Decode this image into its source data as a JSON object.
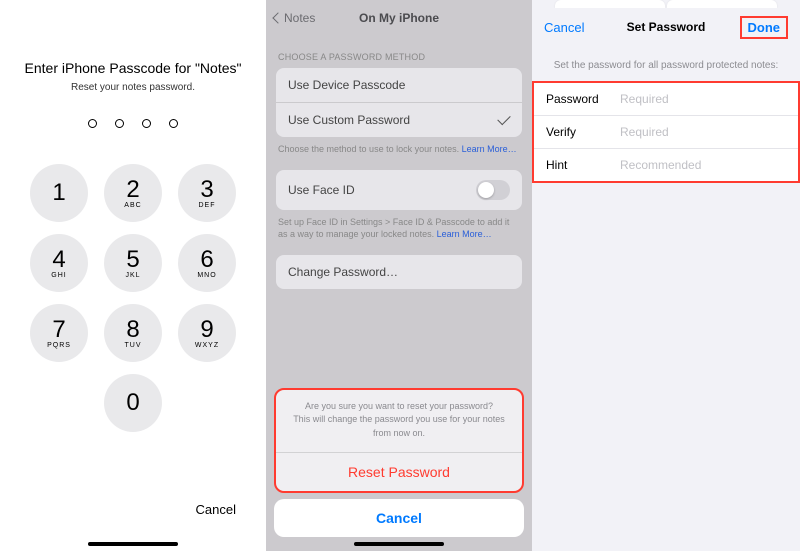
{
  "panel1": {
    "title": "Enter iPhone Passcode for \"Notes\"",
    "subtitle": "Reset your notes password.",
    "keys": [
      {
        "num": "1",
        "let": ""
      },
      {
        "num": "2",
        "let": "ABC"
      },
      {
        "num": "3",
        "let": "DEF"
      },
      {
        "num": "4",
        "let": "GHI"
      },
      {
        "num": "5",
        "let": "JKL"
      },
      {
        "num": "6",
        "let": "MNO"
      },
      {
        "num": "7",
        "let": "PQRS"
      },
      {
        "num": "8",
        "let": "TUV"
      },
      {
        "num": "9",
        "let": "WXYZ"
      },
      {
        "num": "0",
        "let": ""
      }
    ],
    "cancel": "Cancel"
  },
  "panel2": {
    "back": "Notes",
    "title": "On My iPhone",
    "section_header": "CHOOSE A PASSWORD METHOD",
    "method1": "Use Device Passcode",
    "method2": "Use Custom Password",
    "method_footer": "Choose the method to use to lock your notes. ",
    "learn_more": "Learn More…",
    "faceid_label": "Use Face ID",
    "faceid_footer": "Set up Face ID in Settings > Face ID & Passcode to add it as a way to manage your locked notes. ",
    "change_pw": "Change Password…",
    "sheet_msg1": "Are you sure you want to reset your password?",
    "sheet_msg2": "This will change the password you use for your notes from now on.",
    "sheet_reset": "Reset Password",
    "sheet_cancel": "Cancel"
  },
  "panel3": {
    "cancel": "Cancel",
    "title": "Set Password",
    "done": "Done",
    "subtitle": "Set the password for all password protected notes:",
    "fields": [
      {
        "label": "Password",
        "placeholder": "Required"
      },
      {
        "label": "Verify",
        "placeholder": "Required"
      },
      {
        "label": "Hint",
        "placeholder": "Recommended"
      }
    ]
  }
}
